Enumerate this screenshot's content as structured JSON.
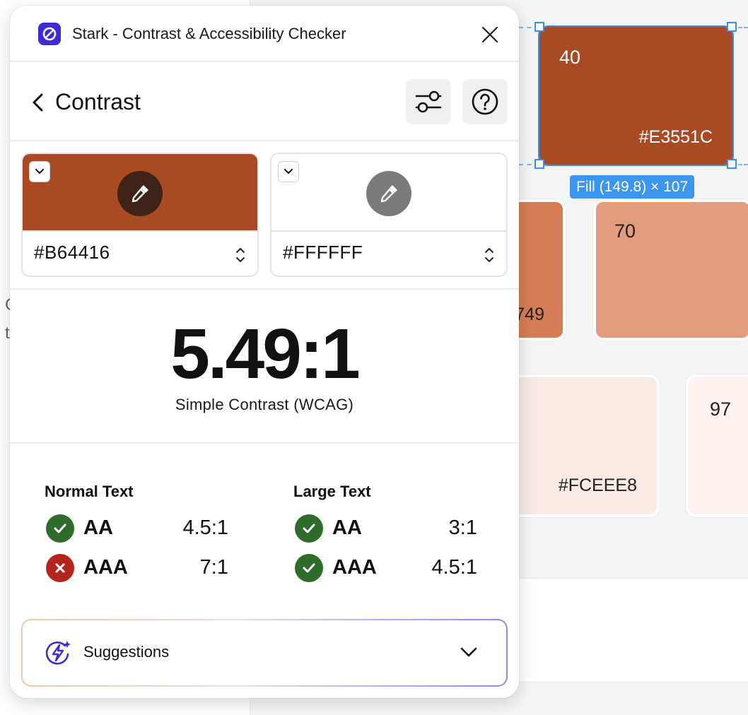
{
  "window": {
    "app_title": "Stark - Contrast & Accessibility Checker"
  },
  "header": {
    "title": "Contrast"
  },
  "colors": {
    "foreground": {
      "hex": "#B64416",
      "swatch": "#a84a24",
      "eyedropper_bg": "#3e2218"
    },
    "background": {
      "hex": "#FFFFFF",
      "swatch": "#ffffff",
      "eyedropper_bg": "#7a7a7a"
    }
  },
  "contrast": {
    "ratio": "5.49:1",
    "method": "Simple Contrast (WCAG)"
  },
  "results": {
    "normal_text": {
      "heading": "Normal Text",
      "rows": [
        {
          "level": "AA",
          "requirement": "4.5:1",
          "pass": true
        },
        {
          "level": "AAA",
          "requirement": "7:1",
          "pass": false
        }
      ]
    },
    "large_text": {
      "heading": "Large Text",
      "rows": [
        {
          "level": "AA",
          "requirement": "3:1",
          "pass": true
        },
        {
          "level": "AAA",
          "requirement": "4.5:1",
          "pass": true
        }
      ]
    },
    "pass_color": "#2f6b2a",
    "fail_color": "#b3261e"
  },
  "suggestions": {
    "label": "Suggestions",
    "icon_color": "#3d2bd1"
  },
  "canvas": {
    "selection_label": "Fill (149.8) × 107",
    "swatches": {
      "s40": {
        "step": "40",
        "hex": "#E3551C",
        "color": "#a84a24"
      },
      "s60": {
        "hex_partial": "749",
        "color": "#d67d56"
      },
      "s70": {
        "step": "70",
        "color": "#e29c7e"
      },
      "s90": {
        "hex": "#FCEEE8",
        "color": "#f8ebe6"
      },
      "s97": {
        "step": "97",
        "color": "#fcf3f0"
      }
    },
    "left_text": [
      "C",
      "t"
    ],
    "accent": "#3c8df0"
  }
}
